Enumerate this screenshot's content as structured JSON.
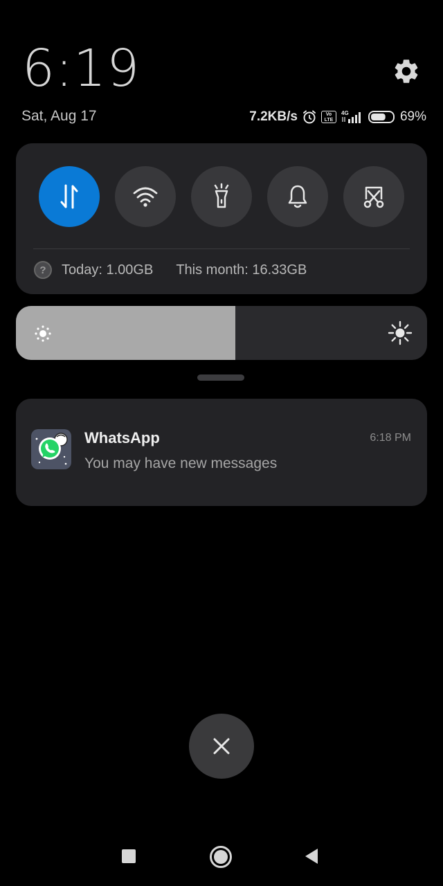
{
  "clock": {
    "time": "6:19"
  },
  "header": {
    "date": "Sat, Aug 17",
    "settings_icon": "gear-icon"
  },
  "status": {
    "speed": "7.2KB/s",
    "alarm_icon": "alarm-clock-icon",
    "volte_icon": "volte-icon",
    "volte_top": "Vo",
    "volte_bottom": "LTE",
    "signal_icon": "signal-4g-icon",
    "network": "4G",
    "battery_icon": "battery-icon",
    "battery_level": 0.69,
    "battery_pct": "69%"
  },
  "quick_settings": {
    "toggles": [
      {
        "name": "mobile-data",
        "icon": "data-arrows-icon",
        "active": true
      },
      {
        "name": "wifi",
        "icon": "wifi-icon",
        "active": false
      },
      {
        "name": "flashlight",
        "icon": "flashlight-icon",
        "active": false
      },
      {
        "name": "sound",
        "icon": "bell-icon",
        "active": false
      },
      {
        "name": "screenshot",
        "icon": "scissors-screenshot-icon",
        "active": false
      }
    ],
    "usage": {
      "help_icon": "help-icon",
      "help_glyph": "?",
      "today": "Today: 1.00GB",
      "month": "This month: 16.33GB"
    }
  },
  "brightness": {
    "level": 0.533,
    "low_icon": "brightness-low-icon",
    "high_icon": "brightness-high-icon"
  },
  "notification": {
    "app": "WhatsApp",
    "text": "You may have new messages",
    "time": "6:18 PM",
    "icon": "whatsapp-icon"
  },
  "dismiss": {
    "icon": "close-icon"
  },
  "navbar": {
    "recents_icon": "square-icon",
    "home_icon": "circle-icon",
    "back_icon": "triangle-back-icon"
  },
  "colors": {
    "accent": "#0a7ad6",
    "panel": "#232326",
    "toggle_off": "#38383b",
    "background": "#000000",
    "whatsapp": "#25d366"
  }
}
